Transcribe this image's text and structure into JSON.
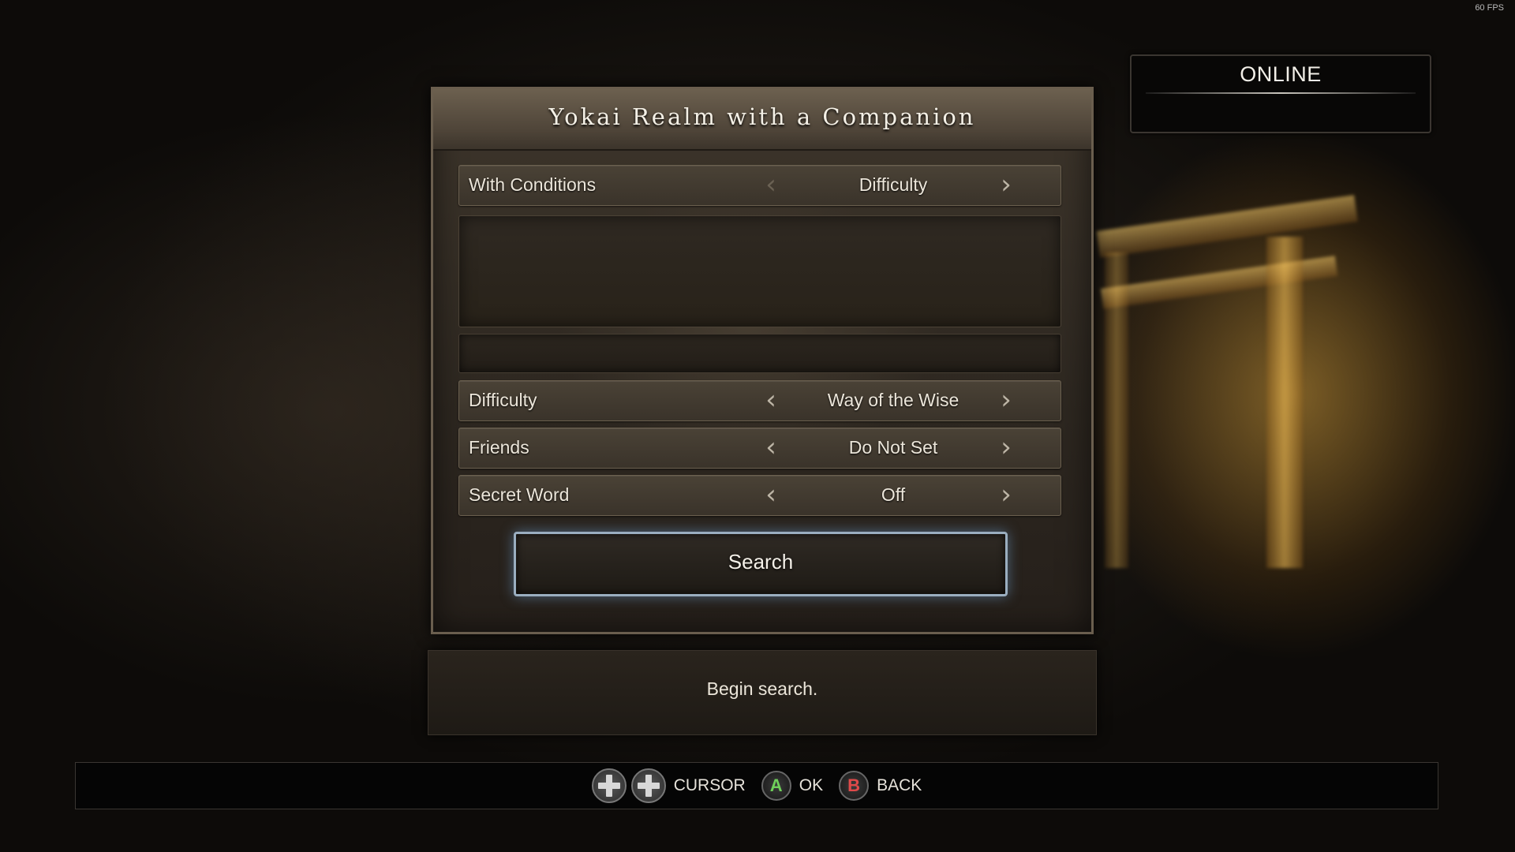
{
  "fps": "60 FPS",
  "online_panel": {
    "title": "ONLINE"
  },
  "panel": {
    "title": "Yokai Realm with a Companion",
    "rows": [
      {
        "label": "With Conditions",
        "value": "Difficulty"
      },
      {
        "label": "Difficulty",
        "value": "Way of the Wise"
      },
      {
        "label": "Friends",
        "value": "Do Not Set"
      },
      {
        "label": "Secret Word",
        "value": "Off"
      }
    ],
    "search_label": "Search"
  },
  "description": "Begin search.",
  "footer": {
    "cursor_label": "CURSOR",
    "a_button": "A",
    "ok_label": "OK",
    "b_button": "B",
    "back_label": "BACK"
  },
  "colors": {
    "a_button": "#6fcf5a",
    "b_button": "#e04a4a",
    "focus_glow": "#9aaec0"
  }
}
